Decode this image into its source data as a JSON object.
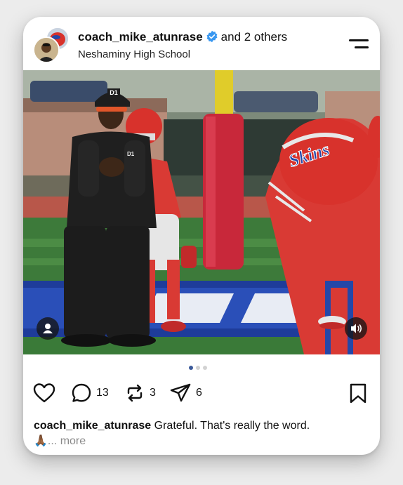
{
  "post": {
    "username": "coach_mike_atunrase",
    "coauthors": "and 2 others",
    "location": "Neshaminy High School",
    "photo": {
      "helmet_text": "Skins",
      "cap_text": "D1",
      "shirt_text": "D1"
    },
    "carousel": {
      "total": 3,
      "active_index": 0
    },
    "stats": {
      "comments": "13",
      "reposts": "3",
      "shares": "6"
    },
    "caption": {
      "user": "coach_mike_atunrase",
      "text": "Grateful. That's really the word.",
      "emoji": "🙏🏾",
      "more": "... more"
    }
  },
  "colors": {
    "verified": "#3897f0",
    "accent_dot": "#3b5a9a",
    "team_red": "#d93a34",
    "team_blue": "#1e3c9a"
  },
  "icons": [
    "menu-icon",
    "verified-icon",
    "user-tag-icon",
    "speaker-icon",
    "heart-icon",
    "comment-icon",
    "repost-icon",
    "share-icon",
    "bookmark-icon"
  ]
}
